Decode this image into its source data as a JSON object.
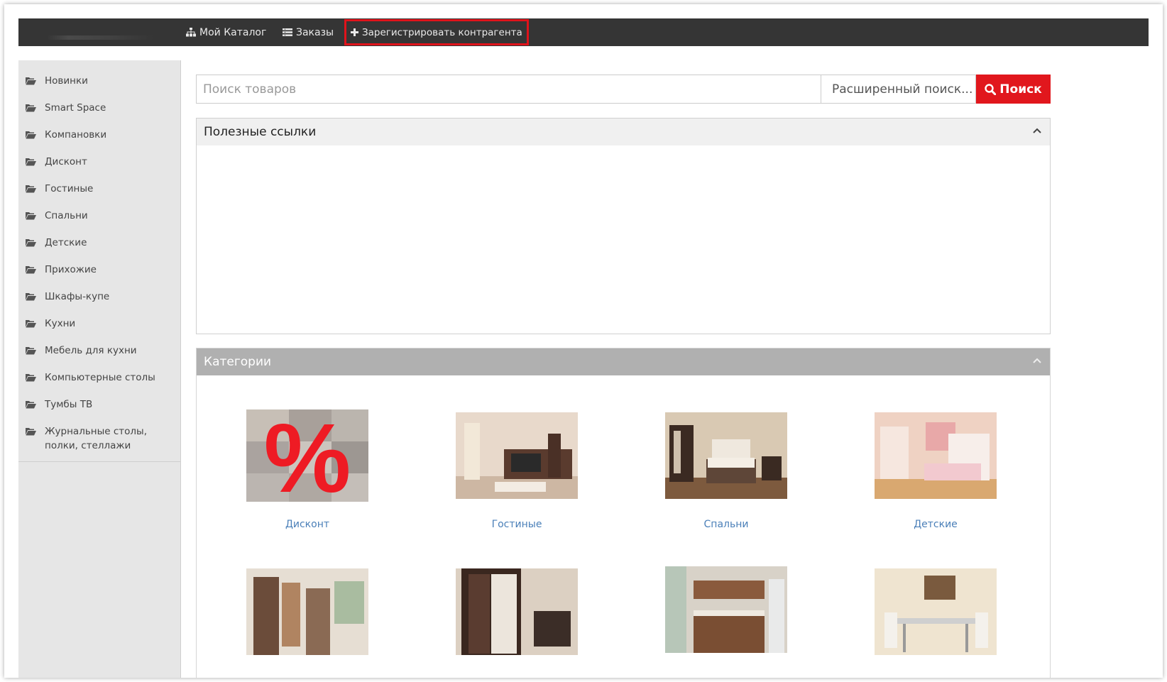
{
  "nav": {
    "catalog_label": "Мой Каталог",
    "orders_label": "Заказы",
    "register_label": "Зарегистрировать контрагента",
    "highlight_color": "#e0131b"
  },
  "sidebar": {
    "items": [
      {
        "label": "Новинки"
      },
      {
        "label": "Smart Space"
      },
      {
        "label": "Компановки"
      },
      {
        "label": "Дисконт"
      },
      {
        "label": "Гостиные"
      },
      {
        "label": "Спальни"
      },
      {
        "label": "Детские"
      },
      {
        "label": "Прихожие"
      },
      {
        "label": "Шкафы-купе"
      },
      {
        "label": "Кухни"
      },
      {
        "label": "Мебель для кухни"
      },
      {
        "label": "Компьютерные столы"
      },
      {
        "label": "Тумбы ТВ"
      },
      {
        "label": "Журнальные столы, полки, стеллажи"
      }
    ]
  },
  "search": {
    "placeholder": "Поиск товаров",
    "advanced_label": "Расширенный поиск...",
    "button_label": "Поиск",
    "button_color": "#e1171d"
  },
  "panels": {
    "links_title": "Полезные ссылки",
    "categories_title": "Категории"
  },
  "categories": [
    {
      "label": "Дисконт",
      "image": "discount-percent-image"
    },
    {
      "label": "Гостиные",
      "image": "living-room-image"
    },
    {
      "label": "Спальни",
      "image": "bedroom-image"
    },
    {
      "label": "Детские",
      "image": "kids-room-image"
    },
    {
      "label": "",
      "image": "hallway-image"
    },
    {
      "label": "",
      "image": "wardrobe-image"
    },
    {
      "label": "",
      "image": "kitchen-image"
    },
    {
      "label": "",
      "image": "dining-room-image"
    }
  ],
  "link_color": "#4a7fb8"
}
